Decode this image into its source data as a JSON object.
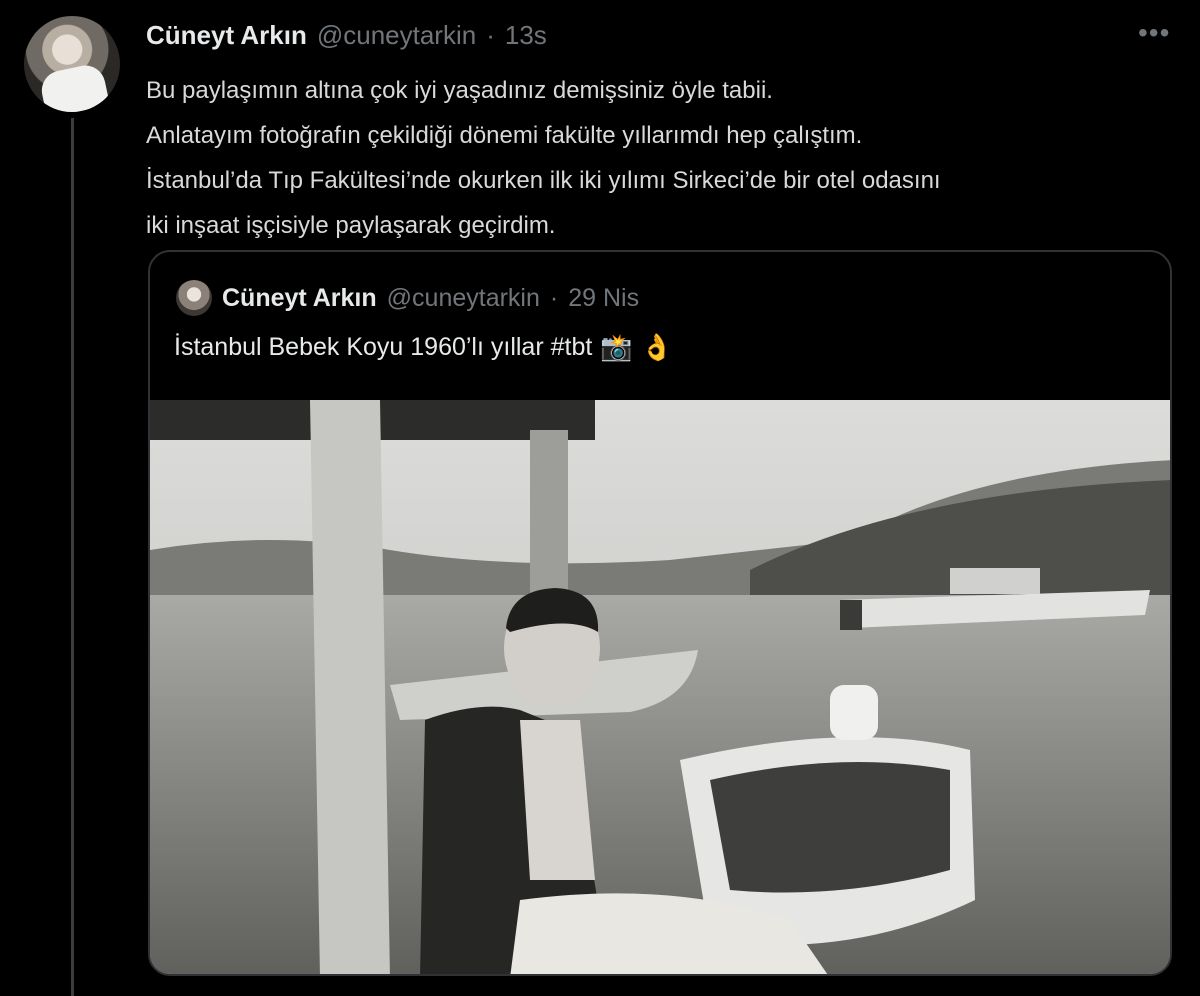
{
  "tweet": {
    "author_name": "Cüneyt Arkın",
    "author_handle": "@cuneytarkin",
    "separator": "·",
    "time": "13s",
    "more_label": "•••",
    "lines": [
      "Bu paylaşımın altına çok iyi yaşadınız demişsiniz öyle tabii.",
      "Anlatayım fotoğrafın çekildiği dönemi fakülte yıllarımdı hep çalıştım.",
      "İstanbul’da Tıp Fakültesi’nde okurken ilk iki yılımı Sirkeci’de bir otel odasını",
      "iki inşaat işçisiyle paylaşarak geçirdim."
    ]
  },
  "quoted_tweet": {
    "author_name": "Cüneyt Arkın",
    "author_handle": "@cuneytarkin",
    "separator": "·",
    "date": "29 Nis",
    "text": "İstanbul Bebek Koyu 1960’lı yıllar  #tbt",
    "emoji_camera": "📸",
    "emoji_ok": "👌"
  },
  "icons": {
    "more": "more-dots-icon"
  }
}
